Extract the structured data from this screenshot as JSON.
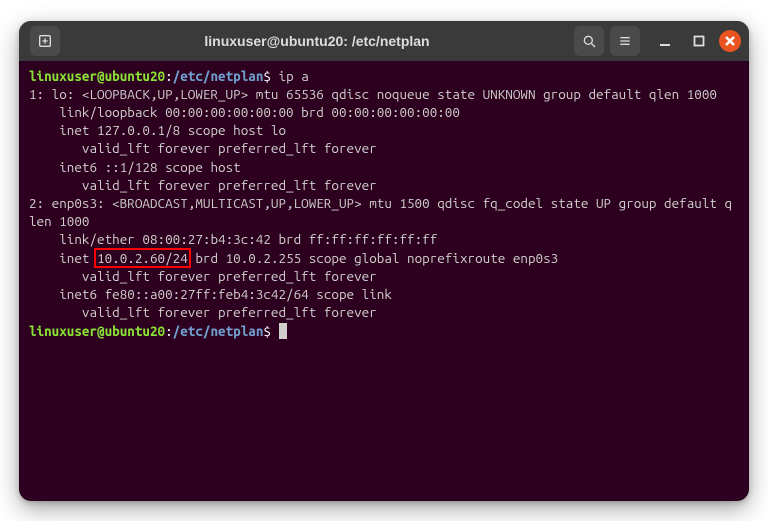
{
  "titlebar": {
    "title": "linuxuser@ubuntu20: /etc/netplan"
  },
  "prompt": {
    "user_host": "linuxuser@ubuntu20",
    "colon": ":",
    "path": "/etc/netplan",
    "dollar": "$"
  },
  "cmd1": "ip a",
  "output": {
    "l1": "1: lo: <LOOPBACK,UP,LOWER_UP> mtu 65536 qdisc noqueue state UNKNOWN group default qlen 1000",
    "l2": "    link/loopback 00:00:00:00:00:00 brd 00:00:00:00:00:00",
    "l3": "    inet 127.0.0.1/8 scope host lo",
    "l4": "       valid_lft forever preferred_lft forever",
    "l5": "    inet6 ::1/128 scope host",
    "l6": "       valid_lft forever preferred_lft forever",
    "l7": "2: enp0s3: <BROADCAST,MULTICAST,UP,LOWER_UP> mtu 1500 qdisc fq_codel state UP group default qlen 1000",
    "l8": "    link/ether 08:00:27:b4:3c:42 brd ff:ff:ff:ff:ff:ff",
    "l9a": "    inet ",
    "l9b": "10.0.2.60/24",
    "l9c": " brd 10.0.2.255 scope global noprefixroute enp0s3",
    "l10": "       valid_lft forever preferred_lft forever",
    "l11": "    inet6 fe80::a00:27ff:feb4:3c42/64 scope link",
    "l12": "       valid_lft forever preferred_lft forever"
  },
  "highlight": {
    "target": "10.0.2.60/24"
  }
}
